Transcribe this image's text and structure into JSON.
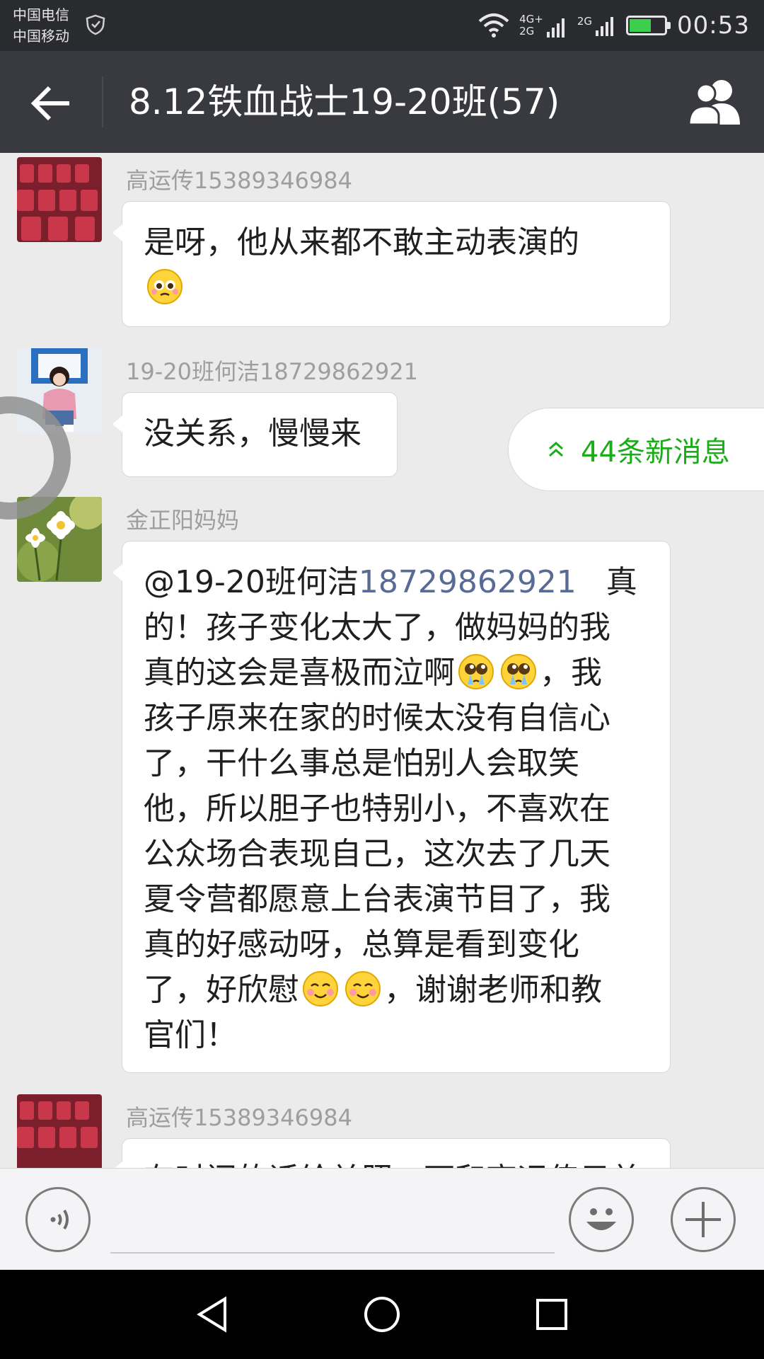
{
  "status_bar": {
    "carrier_1": "中国电信",
    "carrier_2": "中国移动",
    "network_labels": [
      "4G+",
      "2G",
      "2G"
    ],
    "time": "00:53"
  },
  "header": {
    "title": "8.12铁血战士19-20班(57)",
    "back_icon": "back-arrow-icon",
    "members_icon": "group-members-icon"
  },
  "messages": [
    {
      "sender": "高运传15389346984",
      "text": "是呀，他从来都不敢主动表演的",
      "emoji": "pleading-face"
    },
    {
      "sender": "19-20班何洁18729862921",
      "text": "没关系，慢慢来"
    },
    {
      "sender": "金正阳妈妈",
      "mention": "@19-20班何洁",
      "mention_number": "18729862921",
      "line_1_tail": "真",
      "line_2": "的！孩子变化太大了，做妈妈的我",
      "line_3_head": "真的这会是喜极而泣啊",
      "line_3_tail": "，我",
      "line_4": "孩子原来在家的时候太没有自信心",
      "line_5": "了，干什么事总是怕别人会取笑",
      "line_6": "他，所以胆子也特别小，不喜欢在",
      "line_7": "公众场合表现自己，这次去了几天",
      "line_8": "夏令营都愿意上台表演节目了，我",
      "line_9": "真的好感动呀，总算是看到变化",
      "line_10_head": "了，好欣慰",
      "line_10_tail": "，谢谢老师和教",
      "line_11": "官们！"
    },
    {
      "sender": "高运传15389346984",
      "text_partial": "有时间的话给关照一下和高运传只差"
    }
  ],
  "new_messages_badge": "44条新消息",
  "input_bar": {
    "placeholder": ""
  },
  "colors": {
    "accent_green": "#1aad19",
    "mention_blue": "#576b95",
    "title_bar": "#393a3f"
  }
}
